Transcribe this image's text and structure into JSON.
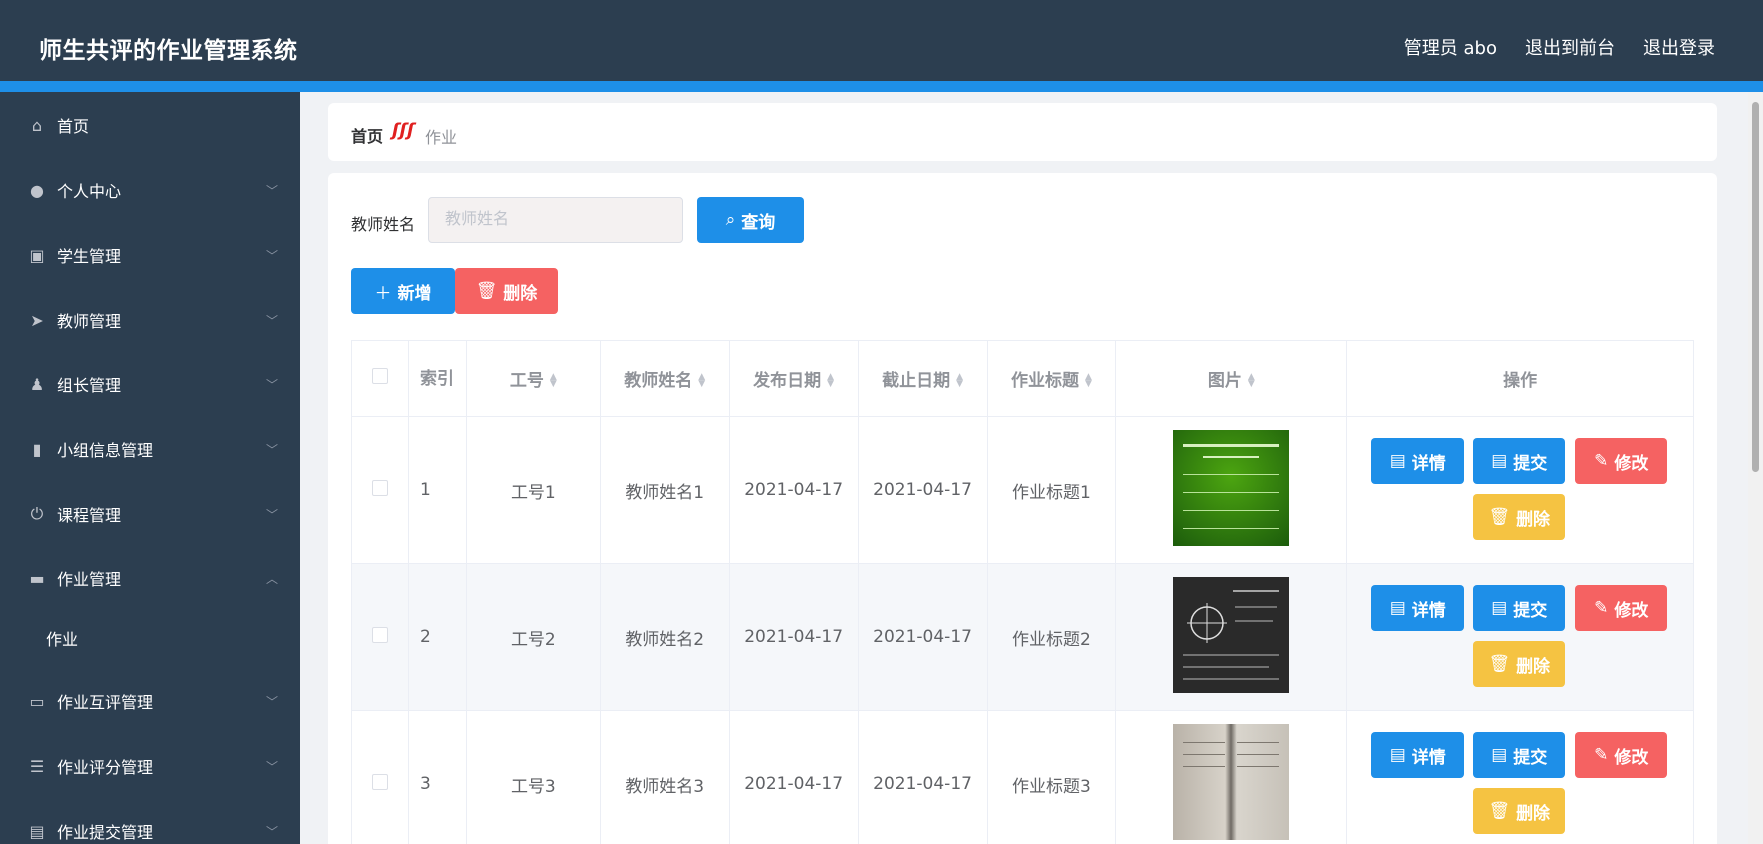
{
  "header": {
    "title": "师生共评的作业管理系统",
    "links": [
      "管理员 abo",
      "退出到前台",
      "退出登录"
    ]
  },
  "sidebar": {
    "items": [
      {
        "label": "首页",
        "icon": "home-icon",
        "glyph": "⌂"
      },
      {
        "label": "个人中心",
        "icon": "user-icon",
        "glyph": "●"
      },
      {
        "label": "学生管理",
        "icon": "clipboard-icon",
        "glyph": "▣"
      },
      {
        "label": "教师管理",
        "icon": "paper-plane-icon",
        "glyph": "➤"
      },
      {
        "label": "组长管理",
        "icon": "person-icon",
        "glyph": "♟"
      },
      {
        "label": "小组信息管理",
        "icon": "bar-chart-icon",
        "glyph": "▮"
      },
      {
        "label": "课程管理",
        "icon": "power-icon",
        "glyph": "⏻"
      },
      {
        "label": "作业管理",
        "icon": "monitor-icon",
        "glyph": "▬"
      },
      {
        "label": "作业互评管理",
        "icon": "desktop-icon",
        "glyph": "▭"
      },
      {
        "label": "作业评分管理",
        "icon": "list-icon",
        "glyph": "☰"
      },
      {
        "label": "作业提交管理",
        "icon": "document-icon",
        "glyph": "▤"
      }
    ],
    "submenu": {
      "label": "作业"
    }
  },
  "breadcrumb": {
    "home": "首页",
    "separator": "ʃʃʃ",
    "current": "作业"
  },
  "search": {
    "label": "教师姓名",
    "placeholder": "教师姓名",
    "value": "",
    "button": "查询"
  },
  "toolbar": {
    "add": "新增",
    "delete": "删除"
  },
  "table": {
    "headers": [
      "索引",
      "工号",
      "教师姓名",
      "发布日期",
      "截止日期",
      "作业标题",
      "图片",
      "操作"
    ],
    "rows": [
      {
        "index": "1",
        "job_no": "工号1",
        "teacher": "教师姓名1",
        "publish": "2021-04-17",
        "deadline": "2021-04-17",
        "title": "作业标题1",
        "image": "green-chart"
      },
      {
        "index": "2",
        "job_no": "工号2",
        "teacher": "教师姓名2",
        "publish": "2021-04-17",
        "deadline": "2021-04-17",
        "title": "作业标题2",
        "image": "blackboard"
      },
      {
        "index": "3",
        "job_no": "工号3",
        "teacher": "教师姓名3",
        "publish": "2021-04-17",
        "deadline": "2021-04-17",
        "title": "作业标题3",
        "image": "notebook"
      }
    ],
    "actions": {
      "detail": "详情",
      "submit": "提交",
      "edit": "修改",
      "delete": "删除"
    }
  },
  "colors": {
    "header_bg": "#2c3e50",
    "accent": "#1e8fe8",
    "danger": "#f56262",
    "warning": "#f5c342"
  }
}
